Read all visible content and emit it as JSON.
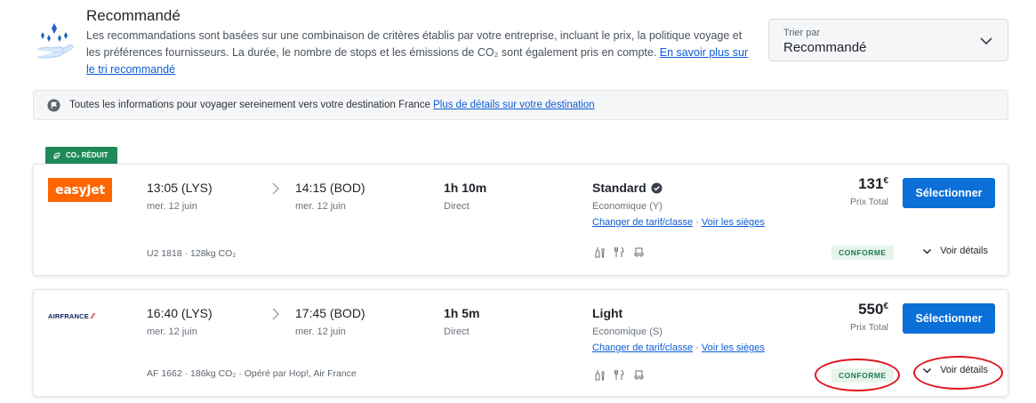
{
  "recommendation": {
    "title": "Recommandé",
    "text": "Les recommandations sont basées sur une combinaison de critères établis par votre entreprise, incluant le prix, la politique voyage et les préférences fournisseurs. La durée, le nombre de stops et les émissions de CO₂ sont également pris en compte.",
    "link": "En savoir plus sur le tri recommandé"
  },
  "sort": {
    "label": "Trier par",
    "value": "Recommandé"
  },
  "info_bar": {
    "text": "Toutes les informations pour voyager sereinement vers votre destination France",
    "link": "Plus de détails sur votre destination"
  },
  "co2_badge": "CO₂ RÉDUIT",
  "flights": [
    {
      "airline_logo": "easyJet",
      "dep_time": "13:05 (LYS)",
      "dep_date": "mer. 12 juin",
      "arr_time": "14:15 (BOD)",
      "arr_date": "mer. 12 juin",
      "duration": "1h 10m",
      "stops": "Direct",
      "fare": "Standard",
      "cabin": "Economique (Y)",
      "link_change": "Changer de tarif/classe",
      "link_sep": " · ",
      "link_seats": "Voir les sièges",
      "footer": "U2 1818 · 128kg CO₂",
      "price": "131",
      "currency": "€",
      "price_label": "Prix Total",
      "select": "Sélectionner",
      "compliance": "CONFORME",
      "details": "Voir détails"
    },
    {
      "airline_logo": "AIRFRANCE",
      "dep_time": "16:40 (LYS)",
      "dep_date": "mer. 12 juin",
      "arr_time": "17:45 (BOD)",
      "arr_date": "mer. 12 juin",
      "duration": "1h 5m",
      "stops": "Direct",
      "fare": "Light",
      "cabin": "Economique (S)",
      "link_change": "Changer de tarif/classe",
      "link_sep": " · ",
      "link_seats": "Voir les sièges",
      "footer": "AF 1662 · 186kg CO₂ · Opéré par Hop!, Air France",
      "price": "550",
      "currency": "€",
      "price_label": "Prix Total",
      "select": "Sélectionner",
      "compliance": "CONFORME",
      "details": "Voir détails"
    }
  ],
  "colors": {
    "accent": "#0a6fd6",
    "link": "#0b5cd5",
    "co2": "#1e8a57",
    "easyjet": "#ff6600",
    "annotation": "#e0141e"
  },
  "icons": [
    "recommendation-icon",
    "chevron-down-icon",
    "flag-icon",
    "leaf-icon",
    "chevron-right-icon",
    "fare-badge-icon",
    "drink-icon",
    "meal-icon",
    "seat-icon"
  ]
}
